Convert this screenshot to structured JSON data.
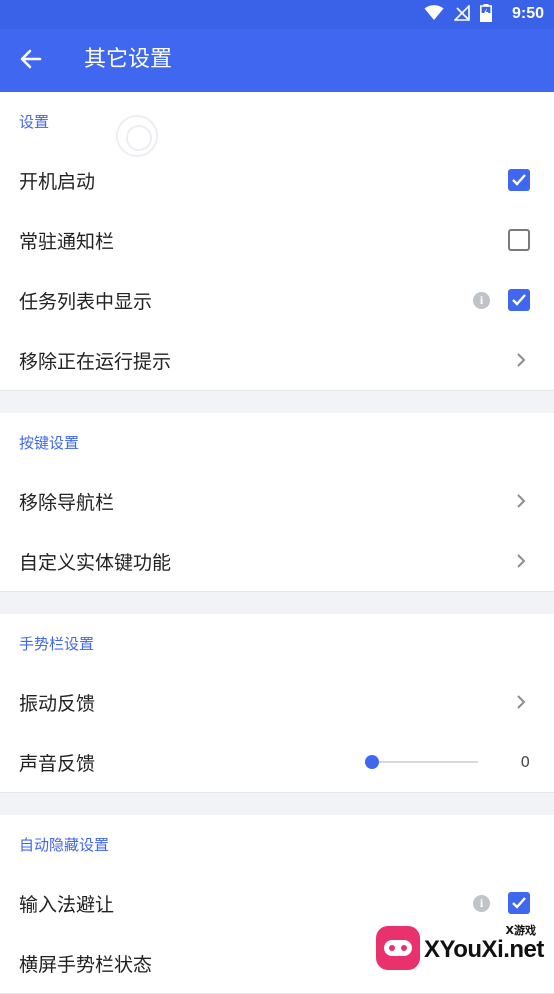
{
  "status_bar": {
    "time": "9:50",
    "icons": [
      "wifi-icon",
      "no-signal-icon",
      "battery-charging-icon"
    ]
  },
  "app_bar": {
    "title": "其它设置",
    "back_icon": "arrow-left-icon"
  },
  "colors": {
    "primary": "#3f67f0",
    "status_bar": "#3a62e8",
    "background": "#f2f3f6",
    "info_icon": "#c0c3c8"
  },
  "sections": [
    {
      "header": "设置",
      "items": [
        {
          "label": "开机启动",
          "control": "checkbox",
          "checked": true
        },
        {
          "label": "常驻通知栏",
          "control": "checkbox",
          "checked": false
        },
        {
          "label": "任务列表中显示",
          "control": "checkbox",
          "checked": true,
          "info": true
        },
        {
          "label": "移除正在运行提示",
          "control": "chevron"
        }
      ]
    },
    {
      "header": "按键设置",
      "items": [
        {
          "label": "移除导航栏",
          "control": "chevron"
        },
        {
          "label": "自定义实体键功能",
          "control": "chevron"
        }
      ]
    },
    {
      "header": "手势栏设置",
      "items": [
        {
          "label": "振动反馈",
          "control": "chevron"
        },
        {
          "label": "声音反馈",
          "control": "slider",
          "value": "0",
          "level": 0
        }
      ]
    },
    {
      "header": "自动隐藏设置",
      "items": [
        {
          "label": "输入法避让",
          "control": "checkbox",
          "checked": true,
          "info": true
        },
        {
          "label": "横屏手势栏状态",
          "control": "none"
        }
      ]
    }
  ],
  "watermark": {
    "small_text": "X游戏",
    "big_text": "XYouXi.net"
  }
}
